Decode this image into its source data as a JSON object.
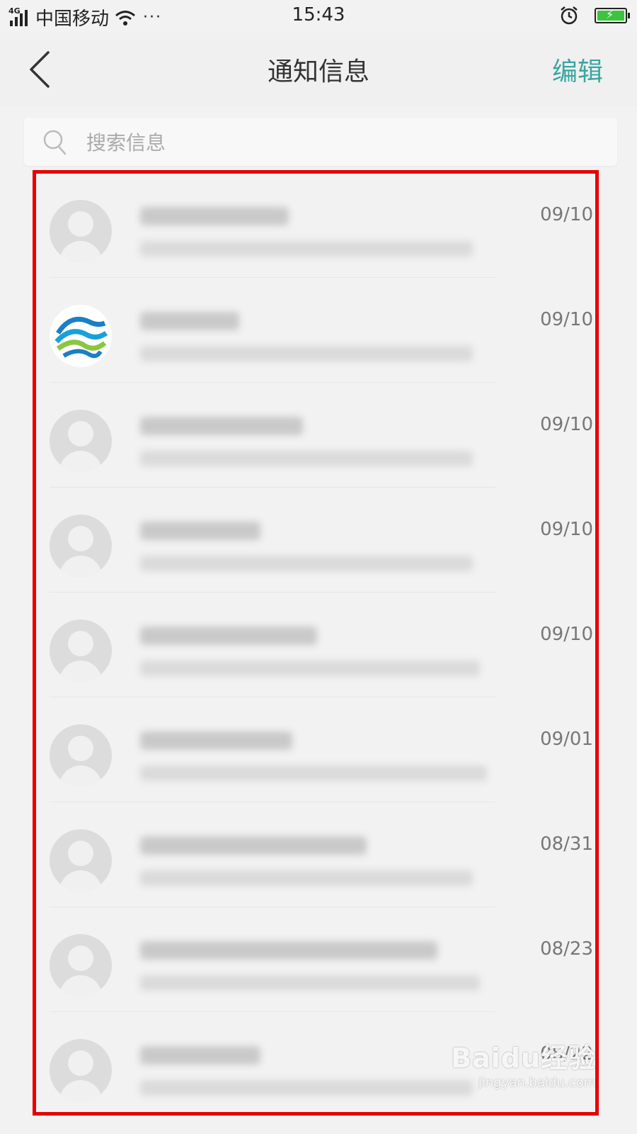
{
  "status_bar": {
    "network": "4G",
    "carrier": "中国移动",
    "more": "···",
    "time": "15:43",
    "battery_color": "#3cc43c",
    "icons": [
      "signal-icon",
      "wifi-icon",
      "alarm-icon",
      "battery-icon"
    ]
  },
  "header": {
    "title": "通知信息",
    "edit_label": "编辑",
    "back_icon": "chevron-left-icon",
    "accent_color": "#3aa6a0"
  },
  "search": {
    "placeholder": "搜索信息",
    "icon": "search-icon"
  },
  "messages": [
    {
      "date": "09/10",
      "avatar": "default-avatar"
    },
    {
      "date": "09/10",
      "avatar": "china-mobile-logo"
    },
    {
      "date": "09/10",
      "avatar": "default-avatar"
    },
    {
      "date": "09/10",
      "avatar": "default-avatar"
    },
    {
      "date": "09/10",
      "avatar": "default-avatar"
    },
    {
      "date": "09/01",
      "avatar": "default-avatar"
    },
    {
      "date": "08/31",
      "avatar": "default-avatar"
    },
    {
      "date": "08/23",
      "avatar": "default-avatar"
    },
    {
      "date": "08/22",
      "avatar": "default-avatar"
    }
  ],
  "highlight_color": "#e60000",
  "watermark": {
    "main": "Baidu经验",
    "sub": "jingyan.baidu.com"
  }
}
